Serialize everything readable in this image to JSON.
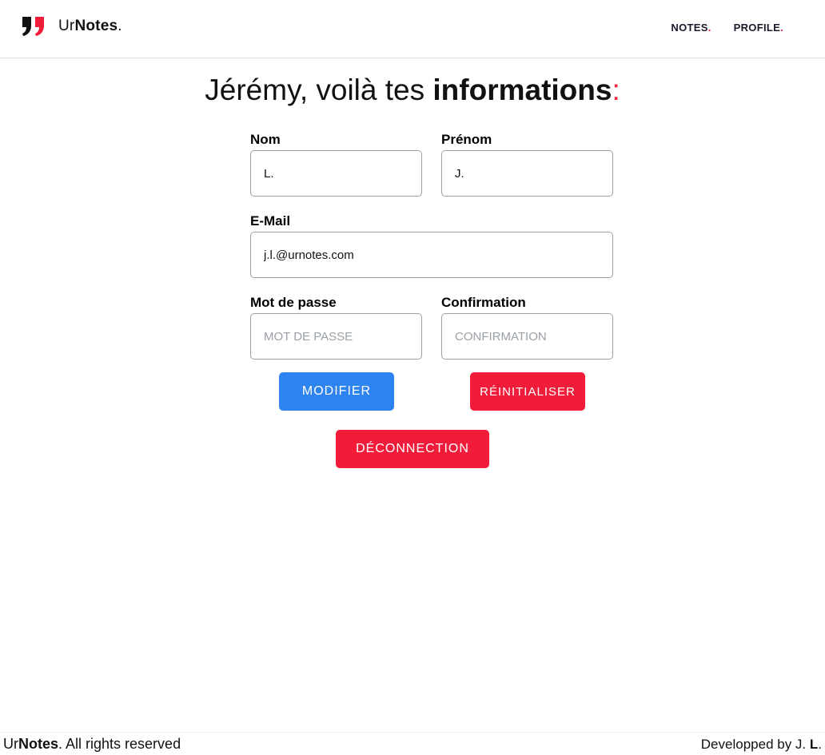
{
  "colors": {
    "accent": "#f01c3a",
    "primary": "#2d83ef",
    "danger": "#f01c3a",
    "text": "#111111"
  },
  "brand": {
    "prefix": "Ur",
    "name": "Notes",
    "dot": "."
  },
  "nav": [
    {
      "label": "NOTES",
      "dot": "."
    },
    {
      "label": "PROFILE",
      "dot": "."
    }
  ],
  "title": {
    "start": "Jérémy, voilà tes ",
    "strong": "informations",
    "end": ":"
  },
  "form": {
    "nom": {
      "label": "Nom",
      "value": "L."
    },
    "prenom": {
      "label": "Prénom",
      "value": "J."
    },
    "email": {
      "label": "E-Mail",
      "value": "j.l.@urnotes.com"
    },
    "password": {
      "label": "Mot de passe",
      "placeholder": "MOT DE PASSE"
    },
    "confirmation": {
      "label": "Confirmation",
      "placeholder": "CONFIRMATION"
    }
  },
  "buttons": {
    "modify": "MODIFIER",
    "reset": "RÉINITIALISER",
    "logout": "DÉCONNECTION"
  },
  "footer": {
    "left_brand_prefix": "Ur",
    "left_brand_name": "Notes",
    "left_text": ". All rights reserved",
    "right_text": "Developped by J. ",
    "right_bold": "L",
    "right_end": "."
  }
}
